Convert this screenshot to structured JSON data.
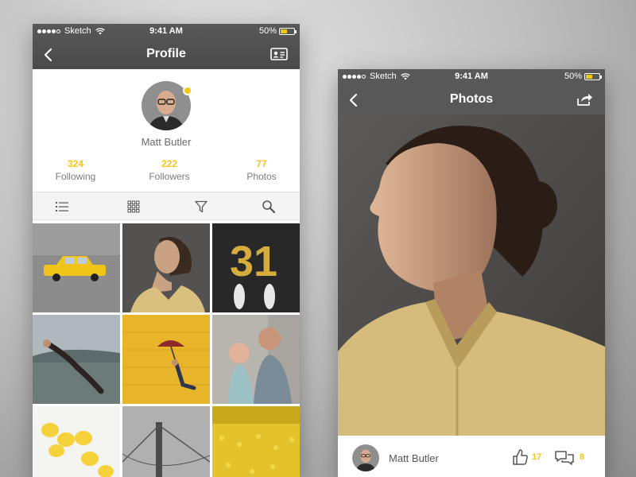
{
  "status_bar": {
    "carrier": "Sketch",
    "time": "9:41 AM",
    "battery_text": "50%",
    "battery_level": 0.5
  },
  "profile_screen": {
    "title": "Profile",
    "user_name": "Matt Butler",
    "stats": [
      {
        "value": "324",
        "label": "Following"
      },
      {
        "value": "222",
        "label": "Followers"
      },
      {
        "value": "77",
        "label": "Photos"
      }
    ],
    "toolbar_icons": [
      "list-icon",
      "grid-icon",
      "filter-icon",
      "search-icon"
    ],
    "photos": [
      "yellow-taxi-photo",
      "woman-portrait-photo",
      "number-31-feet-photo",
      "man-jumping-lake-photo",
      "umbrella-yellow-wall-photo",
      "father-daughter-photo",
      "lemons-photo",
      "bridge-photo",
      "yellow-flowers-field-photo"
    ]
  },
  "photos_screen": {
    "title": "Photos",
    "author_name": "Matt Butler",
    "likes": "17",
    "comments": "8"
  },
  "colors": {
    "accent": "#f5c518",
    "navbar": "#4f4f4f"
  }
}
